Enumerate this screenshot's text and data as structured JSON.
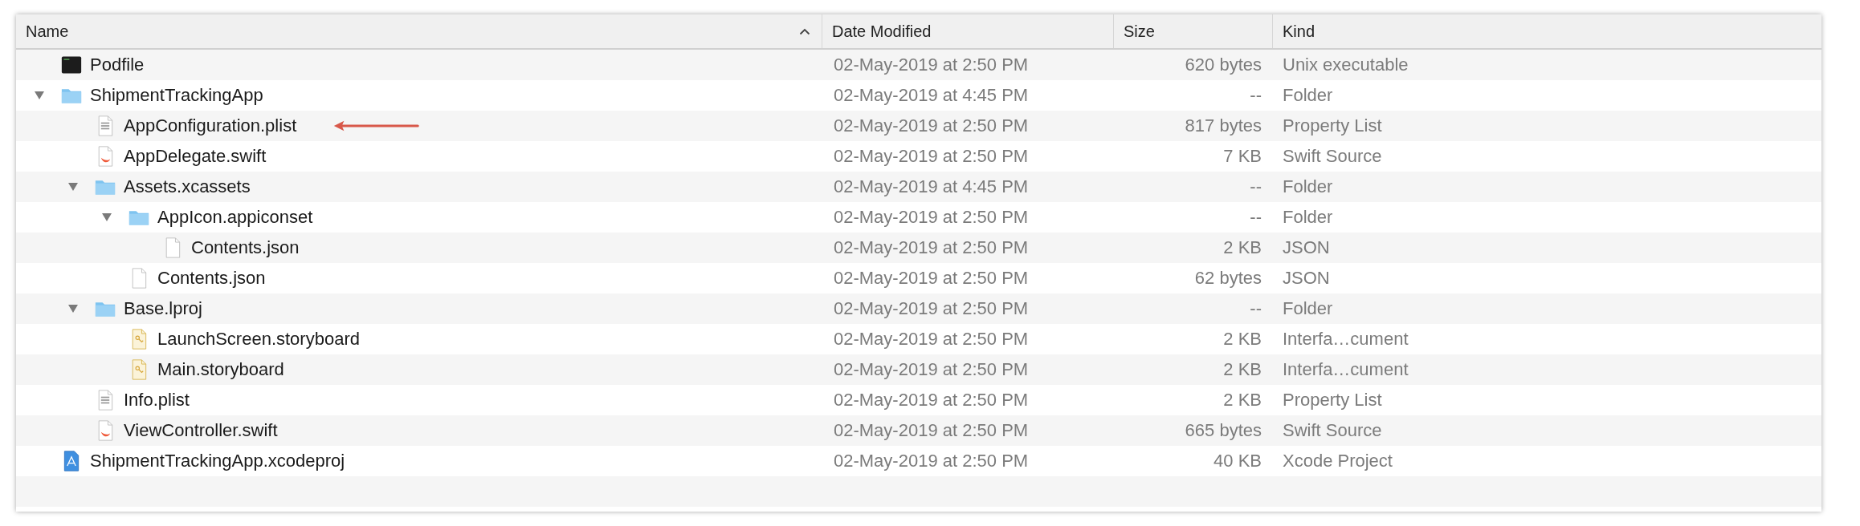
{
  "columns": [
    {
      "label": "Name",
      "sorted": true
    },
    {
      "label": "Date Modified",
      "sorted": false
    },
    {
      "label": "Size",
      "sorted": false
    },
    {
      "label": "Kind",
      "sorted": false
    }
  ],
  "items": [
    {
      "name": "Podfile",
      "kind": "terminal",
      "date": "02-May-2019 at 2:50 PM",
      "size": "620 bytes",
      "type_label": "Unix executable"
    },
    {
      "name": "ShipmentTrackingApp",
      "kind": "folder",
      "expanded": true,
      "date": "02-May-2019 at 4:45 PM",
      "size": "--",
      "type_label": "Folder",
      "children": [
        {
          "name": "AppConfiguration.plist",
          "kind": "plist",
          "annotated": true,
          "date": "02-May-2019 at 2:50 PM",
          "size": "817 bytes",
          "type_label": "Property List"
        },
        {
          "name": "AppDelegate.swift",
          "kind": "swift",
          "date": "02-May-2019 at 2:50 PM",
          "size": "7 KB",
          "type_label": "Swift Source"
        },
        {
          "name": "Assets.xcassets",
          "kind": "folder",
          "expanded": true,
          "date": "02-May-2019 at 4:45 PM",
          "size": "--",
          "type_label": "Folder",
          "children": [
            {
              "name": "AppIcon.appiconset",
              "kind": "folder",
              "expanded": true,
              "date": "02-May-2019 at 2:50 PM",
              "size": "--",
              "type_label": "Folder",
              "children": [
                {
                  "name": "Contents.json",
                  "kind": "blank",
                  "date": "02-May-2019 at 2:50 PM",
                  "size": "2 KB",
                  "type_label": "JSON"
                }
              ]
            },
            {
              "name": "Contents.json",
              "kind": "blank",
              "date": "02-May-2019 at 2:50 PM",
              "size": "62 bytes",
              "type_label": "JSON"
            }
          ]
        },
        {
          "name": "Base.lproj",
          "kind": "folder",
          "expanded": true,
          "date": "02-May-2019 at 2:50 PM",
          "size": "--",
          "type_label": "Folder",
          "children": [
            {
              "name": "LaunchScreen.storyboard",
              "kind": "storyboard",
              "date": "02-May-2019 at 2:50 PM",
              "size": "2 KB",
              "type_label": "Interfa…cument"
            },
            {
              "name": "Main.storyboard",
              "kind": "storyboard",
              "date": "02-May-2019 at 2:50 PM",
              "size": "2 KB",
              "type_label": "Interfa…cument"
            }
          ]
        },
        {
          "name": "Info.plist",
          "kind": "plist",
          "date": "02-May-2019 at 2:50 PM",
          "size": "2 KB",
          "type_label": "Property List"
        },
        {
          "name": "ViewController.swift",
          "kind": "swift",
          "date": "02-May-2019 at 2:50 PM",
          "size": "665 bytes",
          "type_label": "Swift Source"
        }
      ]
    },
    {
      "name": "ShipmentTrackingApp.xcodeproj",
      "kind": "xcodeproj",
      "date": "02-May-2019 at 2:50 PM",
      "size": "40 KB",
      "type_label": "Xcode Project"
    }
  ]
}
